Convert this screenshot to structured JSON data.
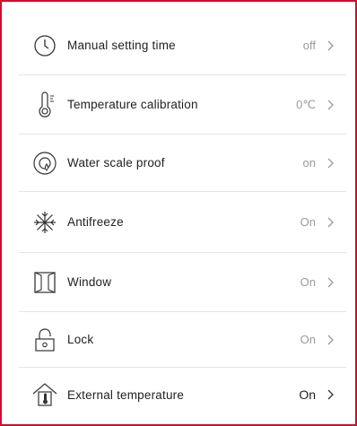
{
  "settings": {
    "items": [
      {
        "label": "Manual setting time",
        "value": "off",
        "icon": "clock-icon"
      },
      {
        "label": "Temperature calibration",
        "value": "0℃",
        "icon": "thermometer-icon"
      },
      {
        "label": "Water scale proof",
        "value": "on",
        "icon": "water-scale-icon"
      },
      {
        "label": "Antifreeze",
        "value": "On",
        "icon": "snowflake-icon"
      },
      {
        "label": "Window",
        "value": "On",
        "icon": "window-icon"
      },
      {
        "label": "Lock",
        "value": "On",
        "icon": "lock-icon"
      },
      {
        "label": "External temperature",
        "value": "On",
        "icon": "external-temperature-icon"
      }
    ]
  },
  "colors": {
    "frame_border": "#c8102e",
    "text": "#222222",
    "value_text": "#9a9a9a",
    "divider": "#e4e4e4"
  }
}
